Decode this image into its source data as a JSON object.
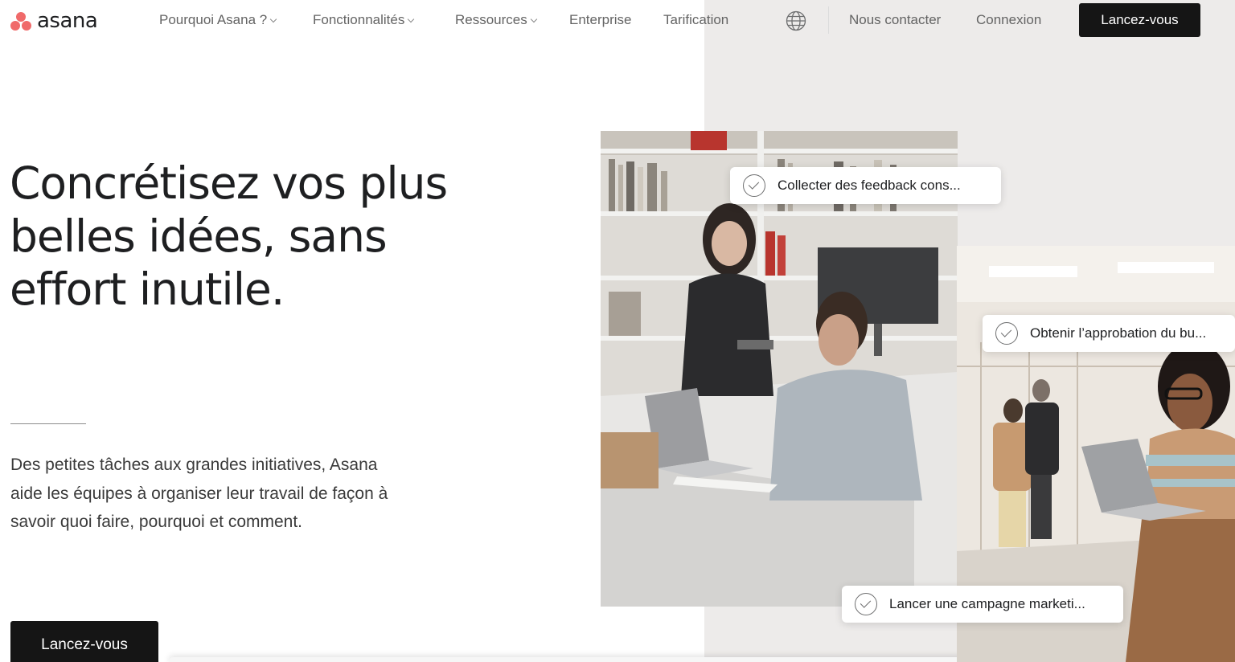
{
  "brand": {
    "name": "asana",
    "accent": "#f06a6a"
  },
  "nav": {
    "items": [
      {
        "label": "Pourquoi Asana ?",
        "has_dropdown": true
      },
      {
        "label": "Fonctionnalités",
        "has_dropdown": true
      },
      {
        "label": "Ressources",
        "has_dropdown": true
      },
      {
        "label": "Enterprise",
        "has_dropdown": false
      },
      {
        "label": "Tarification",
        "has_dropdown": false
      }
    ],
    "language_icon": "globe-icon",
    "contact": "Nous contacter",
    "login": "Connexion",
    "cta": "Lancez-vous"
  },
  "hero": {
    "headline": "Concrétisez vos plus belles idées, sans effort inutile.",
    "subtext": "Des petites tâches aux grandes initiatives, Asana aide les équipes à organiser leur travail de façon à savoir quoi faire, pourquoi et comment.",
    "cta": "Lancez-vous"
  },
  "tasks": [
    {
      "label": "Collecter des feedback cons...",
      "icon": "check-circle-icon"
    },
    {
      "label": "Obtenir l’approbation du bu...",
      "icon": "check-circle-icon"
    },
    {
      "label": "Lancer une campagne marketi...",
      "icon": "check-circle-icon"
    }
  ],
  "colors": {
    "dark_button": "#151515",
    "panel_bg": "#edebea"
  }
}
